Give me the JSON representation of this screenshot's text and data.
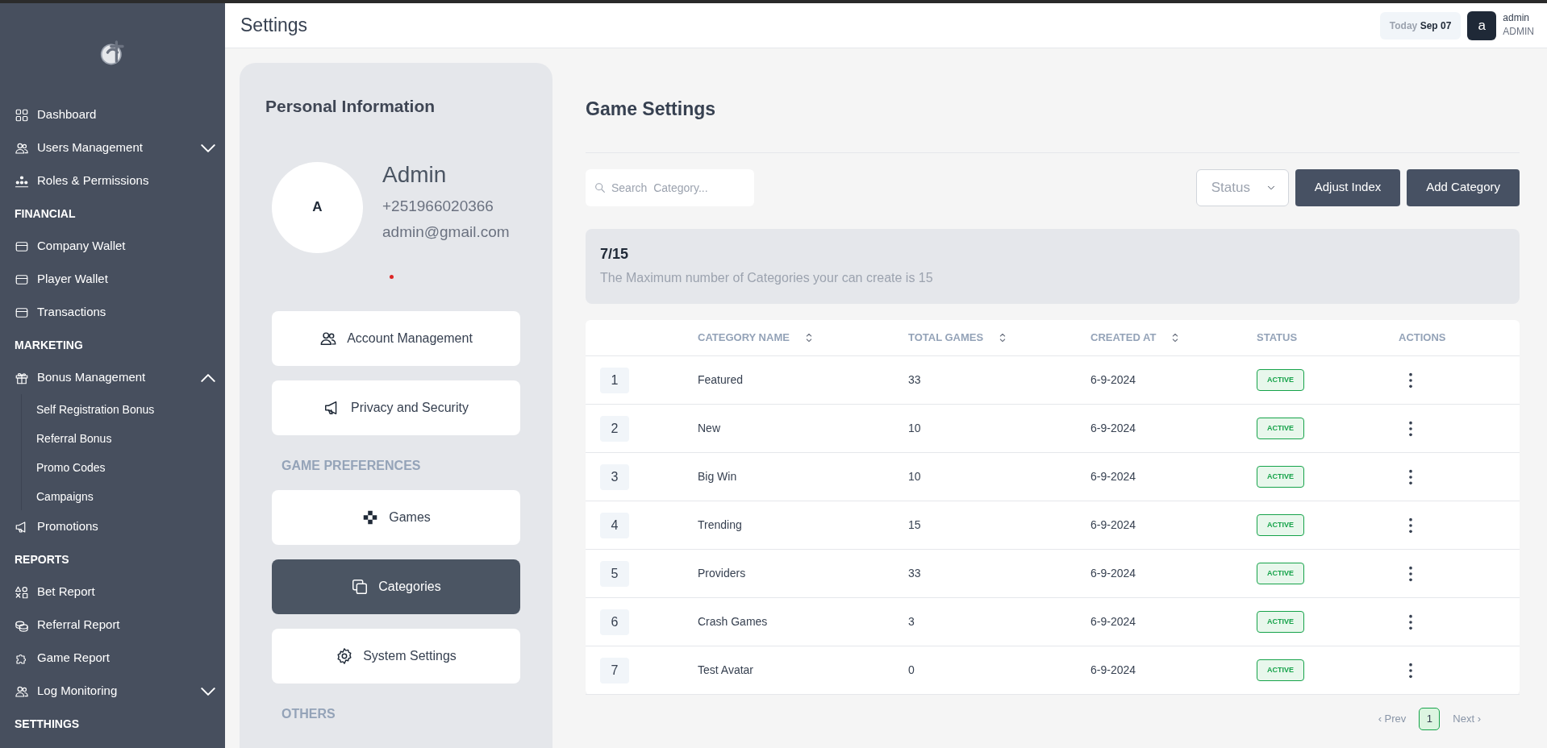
{
  "sidebar": {
    "items": [
      {
        "kind": "item",
        "label": "Dashboard"
      },
      {
        "kind": "group",
        "label": "Users Management",
        "expanded": false
      },
      {
        "kind": "item",
        "label": "Roles & Permissions"
      },
      {
        "kind": "section",
        "label": "FINANCIAL"
      },
      {
        "kind": "item",
        "label": "Company Wallet"
      },
      {
        "kind": "item",
        "label": "Player Wallet"
      },
      {
        "kind": "item",
        "label": "Transactions"
      },
      {
        "kind": "section",
        "label": "MARKETING"
      },
      {
        "kind": "group",
        "label": "Bonus Management",
        "expanded": true,
        "children": [
          {
            "label": "Self Registration Bonus"
          },
          {
            "label": "Referral Bonus"
          },
          {
            "label": "Promo Codes"
          },
          {
            "label": "Campaigns"
          }
        ]
      },
      {
        "kind": "item",
        "label": "Promotions"
      },
      {
        "kind": "section",
        "label": "REPORTS"
      },
      {
        "kind": "item",
        "label": "Bet Report"
      },
      {
        "kind": "item",
        "label": "Referral Report"
      },
      {
        "kind": "item",
        "label": "Game Report"
      },
      {
        "kind": "group",
        "label": "Log Monitoring",
        "expanded": false
      },
      {
        "kind": "section",
        "label": "SETTHINGS"
      }
    ]
  },
  "header": {
    "title": "Settings",
    "date": {
      "prefix": "Today",
      "value": "Sep 07"
    },
    "user": {
      "avatar": "a",
      "name": "admin",
      "role": "ADMIN"
    }
  },
  "profile": {
    "title": "Personal Information",
    "avatar": "A",
    "name": "Admin",
    "phone": "+251966020366",
    "email": "admin@gmail.com",
    "menu": [
      {
        "kind": "button",
        "label": "Account Management",
        "selected": false
      },
      {
        "kind": "button",
        "label": "Privacy and Security",
        "selected": false
      },
      {
        "kind": "section",
        "label": "GAME PREFERENCES"
      },
      {
        "kind": "button",
        "label": "Games",
        "selected": false
      },
      {
        "kind": "button",
        "label": "Categories",
        "selected": true
      },
      {
        "kind": "button",
        "label": "System Settings",
        "selected": false
      },
      {
        "kind": "section",
        "label": "OTHERS"
      }
    ]
  },
  "game_settings": {
    "title": "Game Settings",
    "search": {
      "placeholder": "Search  Category..."
    },
    "status_filter": {
      "label": "Status"
    },
    "buttons": [
      "Adjust Index",
      "Add Category"
    ],
    "quota": {
      "count": "7/15",
      "text": "The Maximum number of Categories your can create is 15"
    },
    "table": {
      "columns": [
        {
          "label": "CATEGORY NAME",
          "sortable": true
        },
        {
          "label": "TOTAL GAMES",
          "sortable": true
        },
        {
          "label": "CREATED AT",
          "sortable": true
        },
        {
          "label": "STATUS",
          "sortable": false
        },
        {
          "label": "ACTIONS",
          "sortable": false
        }
      ],
      "rows": [
        {
          "index": "1",
          "name": "Featured",
          "total_games": "33",
          "created_at": "6-9-2024",
          "status": "ACTIVE"
        },
        {
          "index": "2",
          "name": "New",
          "total_games": "10",
          "created_at": "6-9-2024",
          "status": "ACTIVE"
        },
        {
          "index": "3",
          "name": "Big Win",
          "total_games": "10",
          "created_at": "6-9-2024",
          "status": "ACTIVE"
        },
        {
          "index": "4",
          "name": "Trending",
          "total_games": "15",
          "created_at": "6-9-2024",
          "status": "ACTIVE"
        },
        {
          "index": "5",
          "name": "Providers",
          "total_games": "33",
          "created_at": "6-9-2024",
          "status": "ACTIVE"
        },
        {
          "index": "6",
          "name": "Crash Games",
          "total_games": "3",
          "created_at": "6-9-2024",
          "status": "ACTIVE"
        },
        {
          "index": "7",
          "name": "Test Avatar",
          "total_games": "0",
          "created_at": "6-9-2024",
          "status": "ACTIVE"
        }
      ]
    },
    "pagination": {
      "prev": {
        "label": "‹ Prev",
        "disabled": true
      },
      "pages": [
        {
          "label": "1",
          "selected": true
        }
      ],
      "next": {
        "label": "Next ›",
        "disabled": true
      }
    }
  }
}
